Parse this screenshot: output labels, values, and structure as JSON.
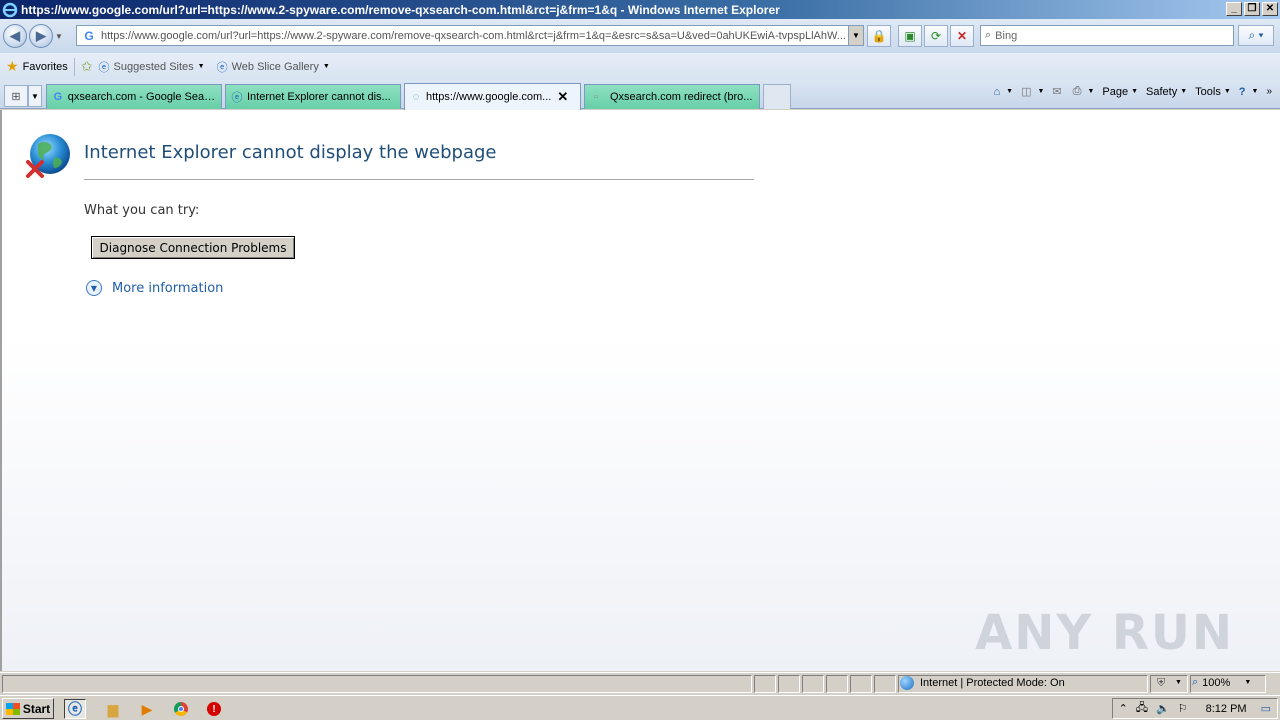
{
  "window": {
    "title": "https://www.google.com/url?url=https://www.2-spyware.com/remove-qxsearch-com.html&rct=j&frm=1&q - Windows Internet Explorer"
  },
  "address_bar": {
    "url": "https://www.google.com/url?url=https://www.2-spyware.com/remove-qxsearch-com.html&rct=j&frm=1&q=&esrc=s&sa=U&ved=0ahUKEwiA-tvpspLlAhW...",
    "search_placeholder": "Bing"
  },
  "favorites_bar": {
    "favorites_label": "Favorites",
    "items": [
      {
        "label": "Suggested Sites"
      },
      {
        "label": "Web Slice Gallery"
      }
    ]
  },
  "tabs": [
    {
      "label": "qxsearch.com - Google Search",
      "icon": "google-icon"
    },
    {
      "label": "Internet Explorer cannot dis...",
      "icon": "ie-icon"
    },
    {
      "label": "https://www.google.com...",
      "icon": "loading-icon",
      "active": true
    },
    {
      "label": "Qxsearch.com redirect (bro...",
      "icon": "page-icon"
    }
  ],
  "command_bar": {
    "page": "Page",
    "safety": "Safety",
    "tools": "Tools"
  },
  "error_page": {
    "title": "Internet Explorer cannot display the webpage",
    "what_you_can_try": "What you can try:",
    "diagnose_button": "Diagnose Connection Problems",
    "more_information": "More information"
  },
  "watermark": "ANY RUN",
  "status_bar": {
    "zone": "Internet | Protected Mode: On",
    "zoom": "100%"
  },
  "taskbar": {
    "start_label": "Start",
    "clock": "8:12 PM"
  }
}
